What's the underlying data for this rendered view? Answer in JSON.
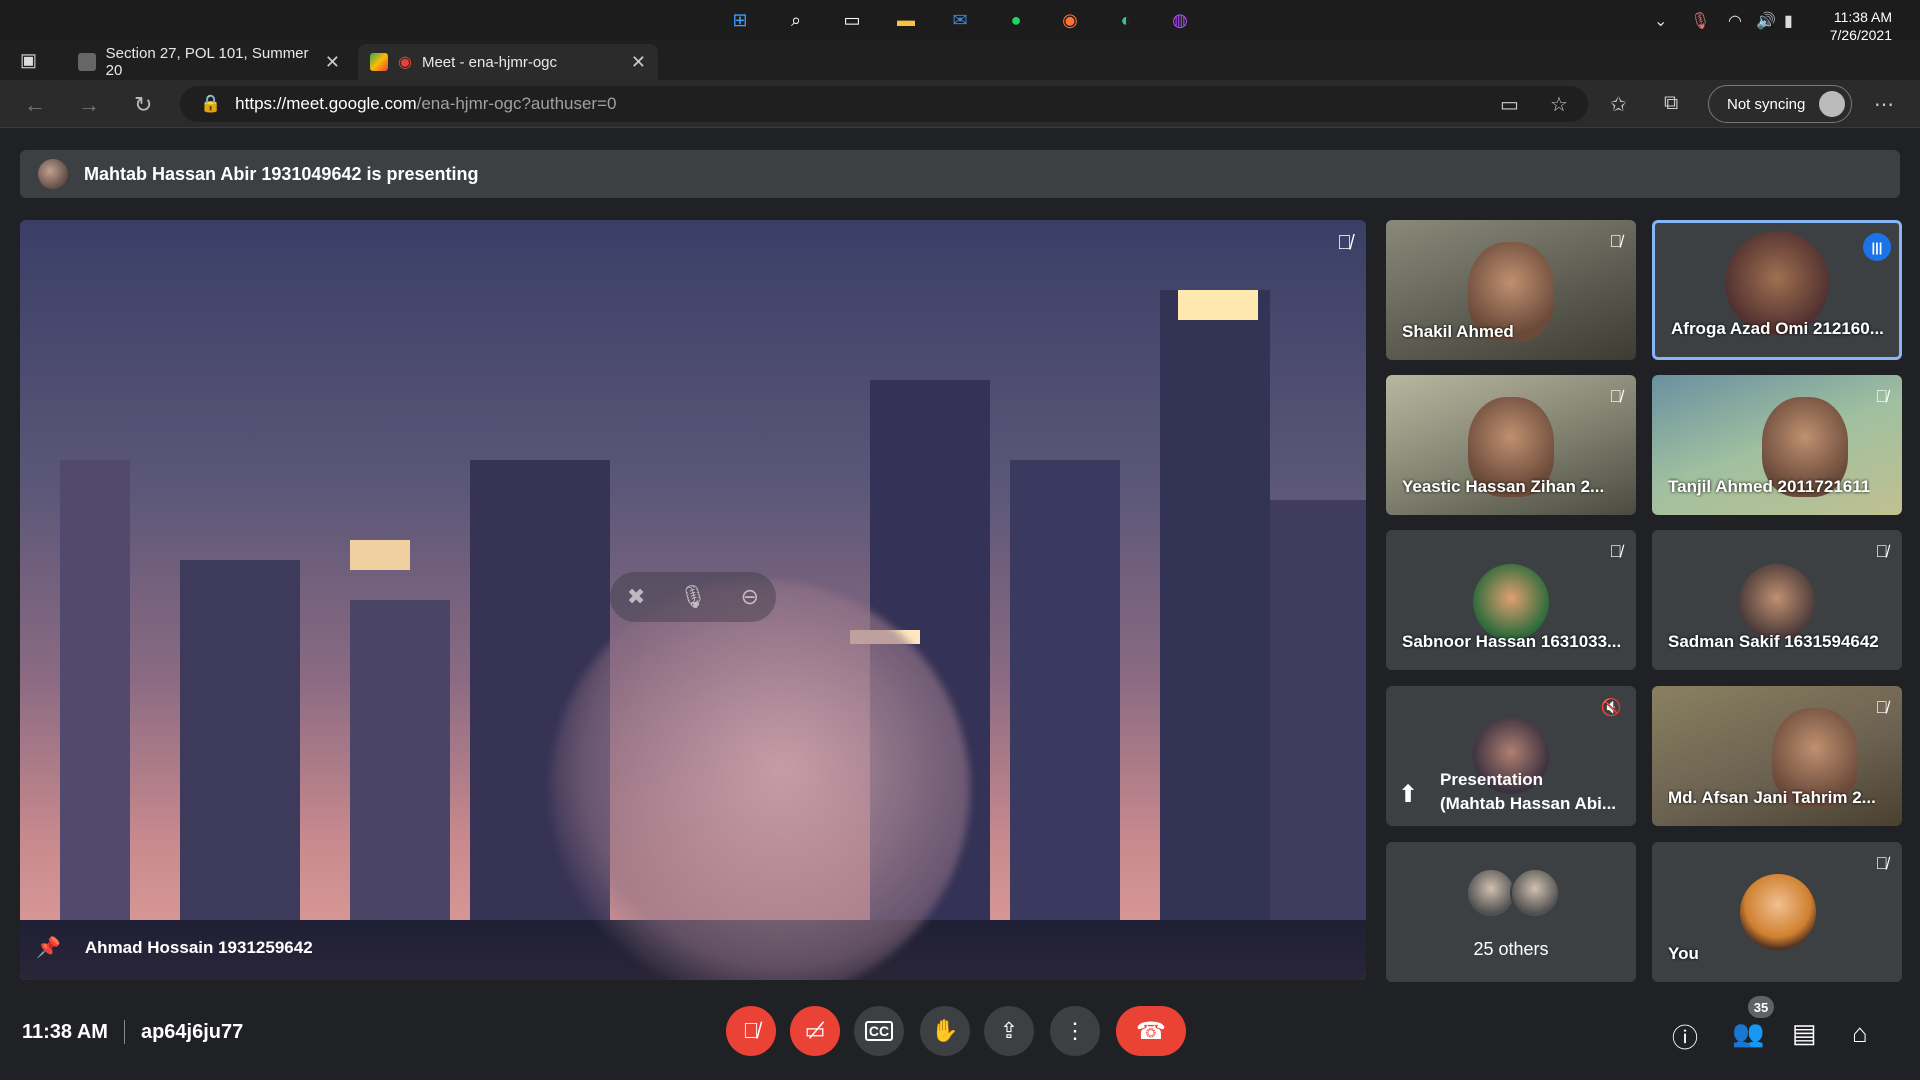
{
  "taskbar": {
    "clock_time": "11:38 AM",
    "clock_date": "7/26/2021",
    "apps": [
      "windows-start-icon",
      "search-icon",
      "task-view-icon",
      "file-explorer-icon",
      "mail-icon",
      "spotify-icon",
      "firefox-icon",
      "edge-icon",
      "messenger-icon"
    ]
  },
  "tabs": [
    {
      "label": "Section 27, POL 101, Summer 20"
    },
    {
      "label": "Meet - ena-hjmr-ogc"
    }
  ],
  "address_bar": {
    "host": "https://meet.google.com",
    "path": "/ena-hjmr-ogc?authuser=0",
    "sync_label": "Not syncing"
  },
  "meet": {
    "banner_text": "Mahtab Hassan Abir 1931049642 is presenting",
    "main_speaker": "Ahmad Hossain 1931259642",
    "tiles": [
      {
        "name": "Shakil Ahmed"
      },
      {
        "name": "Afroga Azad Omi 212160..."
      },
      {
        "name": "Yeastic Hassan Zihan 2..."
      },
      {
        "name": "Tanjil Ahmed 2011721611"
      },
      {
        "name": "Sabnoor Hassan 1631033..."
      },
      {
        "name": "Sadman Sakif 1631594642"
      },
      {
        "name_line1": "Presentation",
        "name_line2": "(Mahtab Hassan Abi..."
      },
      {
        "name": "Md. Afsan Jani Tahrim 2..."
      },
      {
        "name": "25 others"
      },
      {
        "name": "You"
      }
    ],
    "meeting_time": "11:38 AM",
    "meeting_code": "ap64j6ju77",
    "people_count": "35"
  }
}
